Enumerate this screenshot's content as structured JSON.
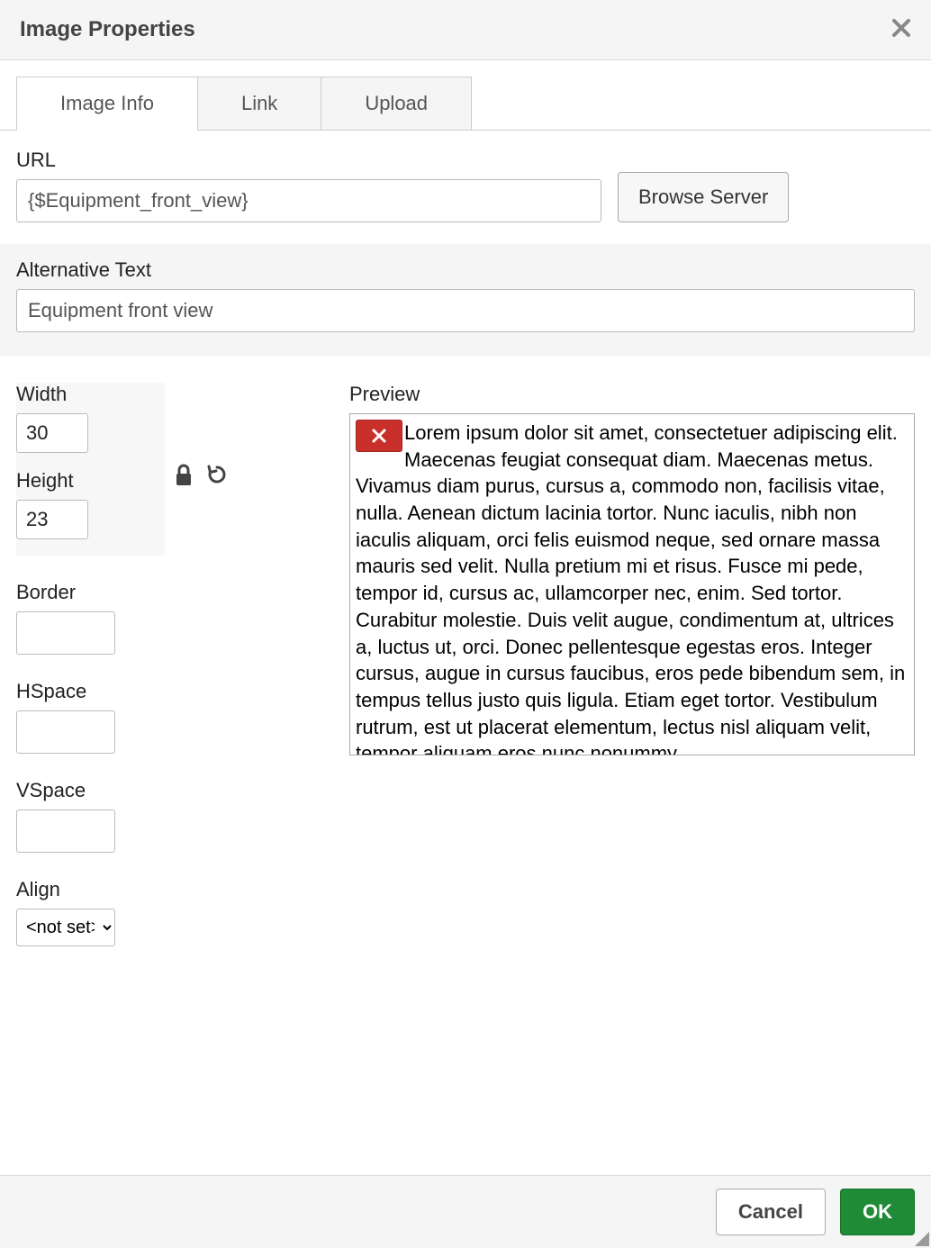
{
  "dialog": {
    "title": "Image Properties"
  },
  "tabs": {
    "image_info": "Image Info",
    "link": "Link",
    "upload": "Upload"
  },
  "fields": {
    "url_label": "URL",
    "url_value": "{$Equipment_front_view}",
    "browse_server": "Browse Server",
    "alt_label": "Alternative Text",
    "alt_value": "Equipment front view",
    "width_label": "Width",
    "width_value": "30",
    "height_label": "Height",
    "height_value": "23",
    "border_label": "Border",
    "border_value": "",
    "hspace_label": "HSpace",
    "hspace_value": "",
    "vspace_label": "VSpace",
    "vspace_value": "",
    "align_label": "Align",
    "align_value": "<not set>",
    "preview_label": "Preview",
    "preview_text": "Lorem ipsum dolor sit amet, consectetuer adipiscing elit. Maecenas feugiat consequat diam. Maecenas metus. Vivamus diam purus, cursus a, commodo non, facilisis vitae, nulla. Aenean dictum lacinia tortor. Nunc iaculis, nibh non iaculis aliquam, orci felis euismod neque, sed ornare massa mauris sed velit. Nulla pretium mi et risus. Fusce mi pede, tempor id, cursus ac, ullamcorper nec, enim. Sed tortor. Curabitur molestie. Duis velit augue, condimentum at, ultrices a, luctus ut, orci. Donec pellentesque egestas eros. Integer cursus, augue in cursus faucibus, eros pede bibendum sem, in tempus tellus justo quis ligula. Etiam eget tortor. Vestibulum rutrum, est ut placerat elementum, lectus nisl aliquam velit, tempor aliquam eros nunc nonummy"
  },
  "footer": {
    "cancel": "Cancel",
    "ok": "OK"
  }
}
